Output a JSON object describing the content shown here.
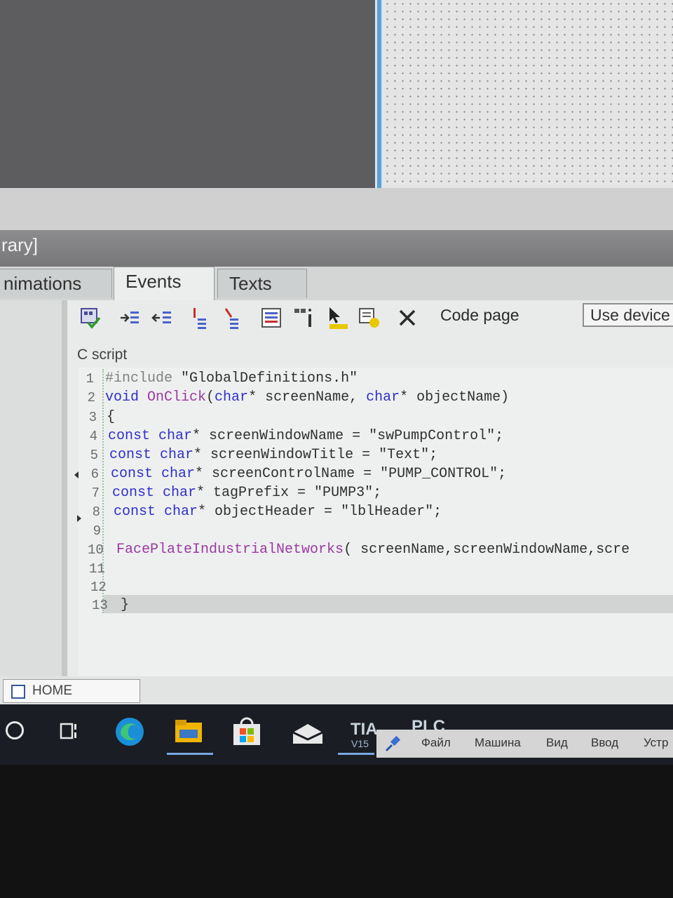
{
  "panel": {
    "title": "rary]"
  },
  "tabs": [
    {
      "label": "nimations"
    },
    {
      "label": "Events"
    },
    {
      "label": "Texts"
    }
  ],
  "toolbar": {
    "buttons": [
      "compile-icon",
      "indent-icon",
      "outdent-icon",
      "comment-icon",
      "uncomment-icon",
      "tag-list-icon",
      "function-list-icon",
      "cursor-icon",
      "properties-icon",
      "delete-icon"
    ],
    "code_page_label": "Code page",
    "code_page_value": "Use device"
  },
  "editor": {
    "label": "C script",
    "lines": [
      {
        "n": "1",
        "tokens": [
          {
            "t": "#include ",
            "c": "pp"
          },
          {
            "t": "\"GlobalDefinitions.h\"",
            "c": "st"
          }
        ]
      },
      {
        "n": "2",
        "tokens": [
          {
            "t": "void ",
            "c": "kw"
          },
          {
            "t": "OnClick",
            "c": "fn"
          },
          {
            "t": "(",
            "c": "st"
          },
          {
            "t": "char",
            "c": "ty"
          },
          {
            "t": "* screenName, ",
            "c": "st"
          },
          {
            "t": "char",
            "c": "ty"
          },
          {
            "t": "* objectName)",
            "c": "st"
          }
        ]
      },
      {
        "n": "3",
        "tokens": [
          {
            "t": "{",
            "c": "st"
          }
        ]
      },
      {
        "n": "4",
        "tokens": [
          {
            "t": "const ",
            "c": "kw"
          },
          {
            "t": "char",
            "c": "ty"
          },
          {
            "t": "* screenWindowName = \"swPumpControl\";",
            "c": "st"
          }
        ]
      },
      {
        "n": "5",
        "tokens": [
          {
            "t": "const ",
            "c": "kw"
          },
          {
            "t": "char",
            "c": "ty"
          },
          {
            "t": "* screenWindowTitle = \"Text\";",
            "c": "st"
          }
        ]
      },
      {
        "n": "6",
        "tokens": [
          {
            "t": "const ",
            "c": "kw"
          },
          {
            "t": "char",
            "c": "ty"
          },
          {
            "t": "* screenControlName = \"PUMP_CONTROL\";",
            "c": "st"
          }
        ]
      },
      {
        "n": "7",
        "tokens": [
          {
            "t": "const ",
            "c": "kw"
          },
          {
            "t": "char",
            "c": "ty"
          },
          {
            "t": "* tagPrefix = \"PUMP3\";",
            "c": "st"
          }
        ]
      },
      {
        "n": "8",
        "tokens": [
          {
            "t": "const ",
            "c": "kw"
          },
          {
            "t": "char",
            "c": "ty"
          },
          {
            "t": "* objectHeader = \"lblHeader\";",
            "c": "st"
          }
        ]
      },
      {
        "n": "9",
        "tokens": []
      },
      {
        "n": "10",
        "tokens": [
          {
            "t": "FacePlateIndustrialNetworks",
            "c": "fn"
          },
          {
            "t": "( screenName,screenWindowName,scre",
            "c": "st"
          }
        ]
      },
      {
        "n": "11",
        "tokens": []
      },
      {
        "n": "12",
        "tokens": []
      },
      {
        "n": "13",
        "tokens": [
          {
            "t": "}",
            "c": "st"
          }
        ]
      }
    ]
  },
  "status": {
    "home_label": "HOME"
  },
  "taskbar": {
    "tia_label": "TIA",
    "tia_version": "V15",
    "plc_label": "PLC",
    "vm_menu": [
      "Файл",
      "Машина",
      "Вид",
      "Ввод",
      "Устр"
    ]
  }
}
